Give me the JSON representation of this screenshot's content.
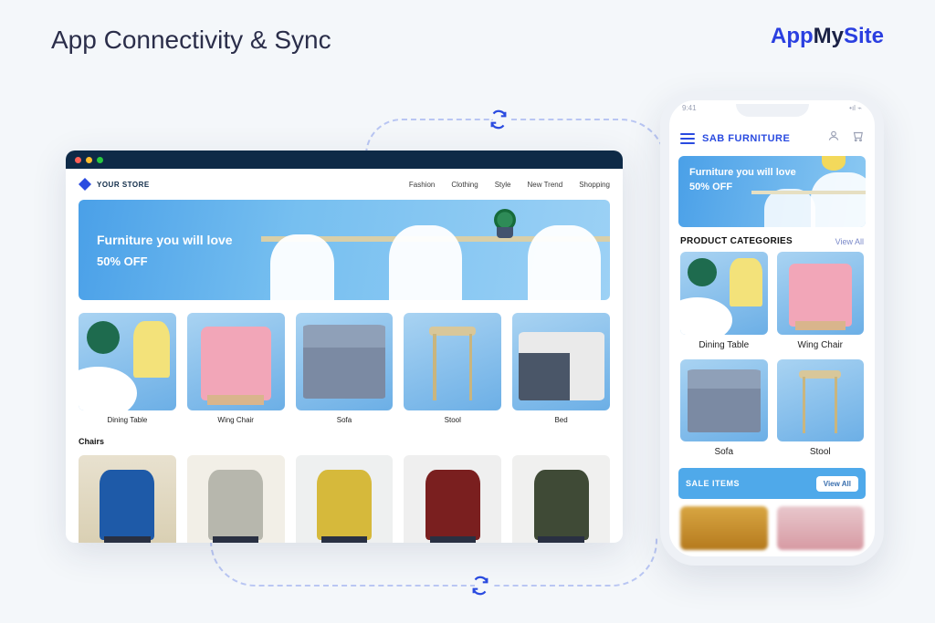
{
  "page": {
    "title": "App Connectivity & Sync",
    "brand": {
      "part1": "App",
      "part2": "My",
      "part3": "Site"
    }
  },
  "desktop": {
    "store_name": "YOUR STORE",
    "nav": [
      "Fashion",
      "Clothing",
      "Style",
      "New Trend",
      "Shopping"
    ],
    "hero": {
      "headline": "Furniture you will love",
      "promo": "50% OFF"
    },
    "categories": [
      {
        "label": "Dining Table"
      },
      {
        "label": "Wing Chair"
      },
      {
        "label": "Sofa"
      },
      {
        "label": "Stool"
      },
      {
        "label": "Bed"
      }
    ],
    "section2_title": "Chairs"
  },
  "phone": {
    "status": {
      "time": "9:41"
    },
    "title": "SAB FURNITURE",
    "hero": {
      "headline": "Furniture you will love",
      "promo": "50% OFF"
    },
    "cats_header": "PRODUCT CATEGORIES",
    "view_all": "View All",
    "categories": [
      {
        "label": "Dining Table"
      },
      {
        "label": "Wing Chair"
      },
      {
        "label": "Sofa"
      },
      {
        "label": "Stool"
      }
    ],
    "sale": {
      "title": "SALE ITEMS",
      "button": "View All"
    }
  }
}
